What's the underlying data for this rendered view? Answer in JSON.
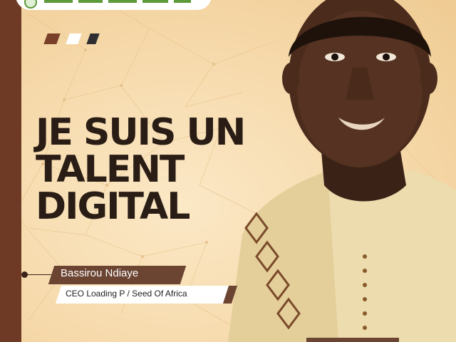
{
  "headline": {
    "line1": "JE SUIS UN",
    "line2": "TALENT",
    "line3": "DIGITAL"
  },
  "person": {
    "name": "Bassirou Ndiaye",
    "role": "CEO Loading P / Seed Of Africa"
  },
  "colors": {
    "brand_brown": "#6e3a25",
    "background": "#f6dcb0",
    "headline": "#2a1d15",
    "name_tag": "#6b4432"
  }
}
